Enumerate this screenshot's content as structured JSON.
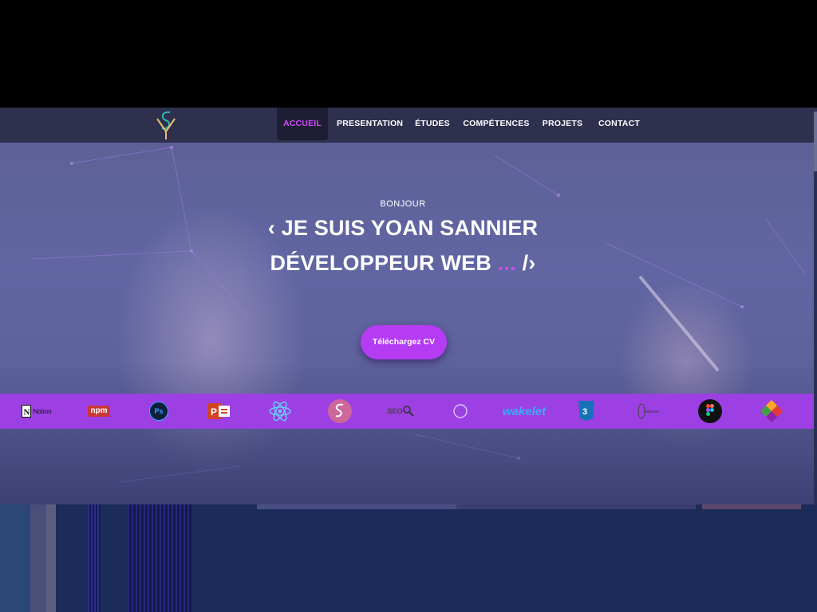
{
  "nav": {
    "items": [
      {
        "label": "ACCUEIL",
        "active": true
      },
      {
        "label": "PRESENTATION",
        "active": false
      },
      {
        "label": "ÉTUDES",
        "active": false
      },
      {
        "label": "COMPÉTENCES",
        "active": false
      },
      {
        "label": "PROJETS",
        "active": false
      },
      {
        "label": "CONTACT",
        "active": false
      }
    ]
  },
  "hero": {
    "greeting": "BONJOUR",
    "line1": "‹ JE SUIS  YOAN  SANNIER",
    "line2_text": "DÉVELOPPEUR WEB",
    "line2_dots": "...",
    "line2_close": "/›",
    "cv_button": "Téléchargez CV"
  },
  "tech_icons": {
    "notion": "Notion",
    "npm": "npm",
    "photoshop": "Ps",
    "seo": "SEO",
    "wakelet": "wakelet"
  },
  "colors": {
    "accent": "#d24bff",
    "band": "#9c40e4",
    "button": "#b53cf2",
    "navbar": "#2a2c48"
  }
}
